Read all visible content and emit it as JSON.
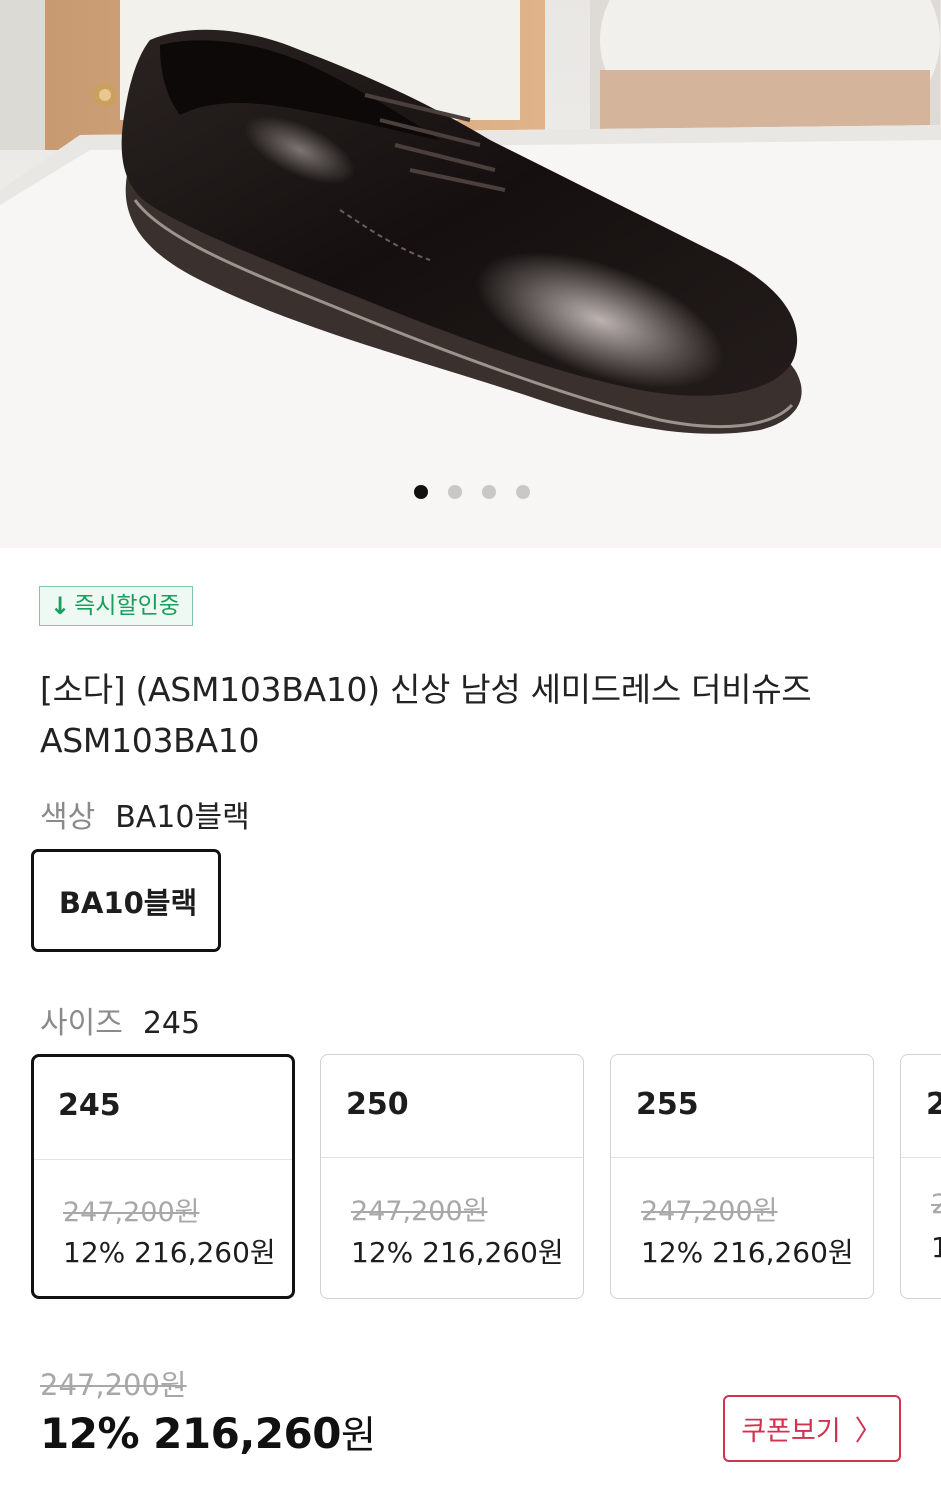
{
  "gallery": {
    "image_label": "black patent leather derby shoe",
    "dots": [
      true,
      false,
      false,
      false
    ]
  },
  "badge": {
    "icon": "down-arrow-icon",
    "label": "즉시할인중",
    "color": "#1a9e5c"
  },
  "product": {
    "title": "[소다] (ASM103BA10) 신상 남성 세미드레스 더비슈즈 ASM103BA10"
  },
  "color_option": {
    "label": "색상",
    "selected": "BA10블랙",
    "chips": [
      "BA10블랙"
    ]
  },
  "size_option": {
    "label": "사이즈",
    "selected": "245",
    "cards": [
      {
        "size": "245",
        "original_price": "247,200원",
        "sale": "12% 216,260원",
        "selected": true
      },
      {
        "size": "250",
        "original_price": "247,200원",
        "sale": "12% 216,260원",
        "selected": false
      },
      {
        "size": "255",
        "original_price": "247,200원",
        "sale": "12% 216,260원",
        "selected": false
      },
      {
        "size": "2",
        "original_price": "2",
        "sale": "1",
        "selected": false
      }
    ]
  },
  "price": {
    "original": "247,200원",
    "discount": "12%",
    "sale_amount": "216,260",
    "currency": "원"
  },
  "coupon": {
    "label": "쿠폰보기",
    "icon": "chevron-right-icon",
    "color": "#d3324f"
  }
}
